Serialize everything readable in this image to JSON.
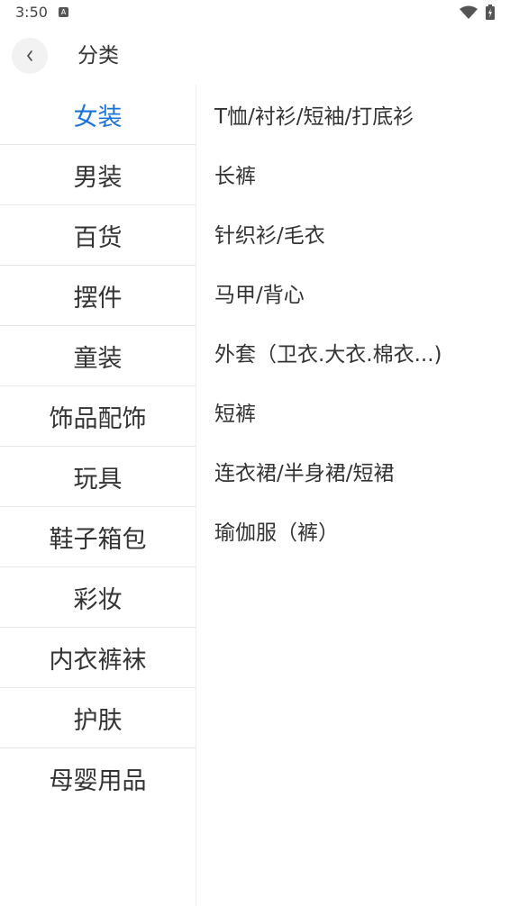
{
  "status_bar": {
    "time": "3:50",
    "notification_icon": "a-icon",
    "icons": [
      "wifi-icon",
      "battery-icon"
    ]
  },
  "header": {
    "back_icon": "chevron-left-icon",
    "title": "分类"
  },
  "colors": {
    "accent": "#1a73d9",
    "text": "#333333",
    "divider": "#e6e6e6"
  },
  "sidebar": {
    "selected_index": 0,
    "items": [
      {
        "label": "女装"
      },
      {
        "label": "男装"
      },
      {
        "label": "百货"
      },
      {
        "label": "摆件"
      },
      {
        "label": "童装"
      },
      {
        "label": "饰品配饰"
      },
      {
        "label": "玩具"
      },
      {
        "label": "鞋子箱包"
      },
      {
        "label": "彩妆"
      },
      {
        "label": "内衣裤袜"
      },
      {
        "label": "护肤"
      },
      {
        "label": "母婴用品"
      }
    ]
  },
  "subcategories": [
    {
      "label": "T恤/衬衫/短袖/打底衫"
    },
    {
      "label": "长裤"
    },
    {
      "label": "针织衫/毛衣"
    },
    {
      "label": "马甲/背心"
    },
    {
      "label": "外套（卫衣.大衣.棉衣...)"
    },
    {
      "label": "短裤"
    },
    {
      "label": "连衣裙/半身裙/短裙"
    },
    {
      "label": "瑜伽服（裤）"
    }
  ]
}
